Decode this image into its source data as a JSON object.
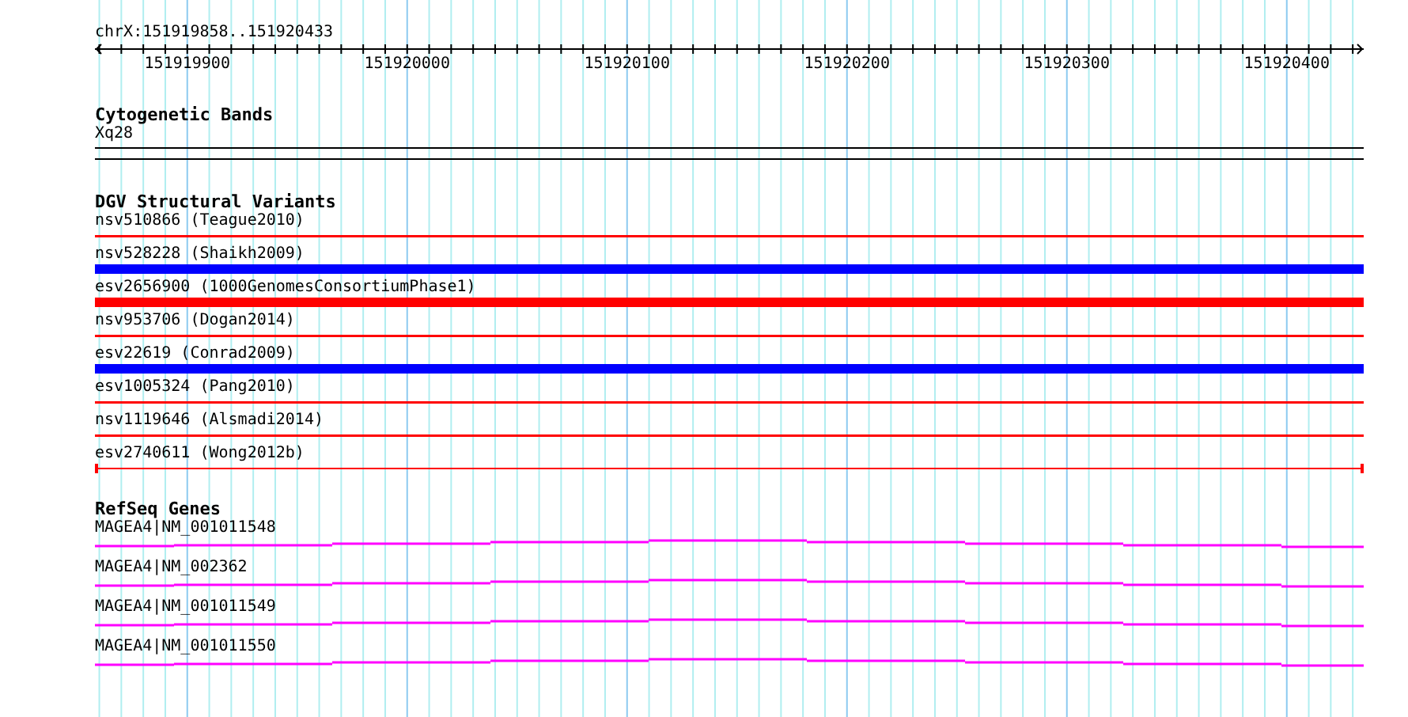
{
  "ruler": {
    "region": "chrX:151919858..151920433",
    "ticks": [
      "151919900",
      "151920000",
      "151920100",
      "151920200",
      "151920300",
      "151920400"
    ]
  },
  "tracks": [
    {
      "kind": "cytoband",
      "title": "Cytogenetic Bands",
      "features": [
        {
          "label": "Xq28"
        }
      ]
    },
    {
      "kind": "variants",
      "title": "DGV Structural Variants",
      "features": [
        {
          "label": "nsv510866 (Teague2010)",
          "kind": "thin",
          "color": "#ff0000"
        },
        {
          "label": "nsv528228 (Shaikh2009)",
          "kind": "thick",
          "color": "#0000ff"
        },
        {
          "label": "esv2656900 (1000GenomesConsortiumPhase1)",
          "kind": "thick",
          "color": "#ff0000"
        },
        {
          "label": "nsv953706 (Dogan2014)",
          "kind": "thin",
          "color": "#ff0000"
        },
        {
          "label": "esv22619 (Conrad2009)",
          "kind": "thick",
          "color": "#0000ff"
        },
        {
          "label": "esv1005324 (Pang2010)",
          "kind": "thin",
          "color": "#ff0000"
        },
        {
          "label": "nsv1119646 (Alsmadi2014)",
          "kind": "thin",
          "color": "#ff0000"
        },
        {
          "label": "esv2740611 (Wong2012b)",
          "kind": "capped",
          "color": "#ff0000"
        }
      ]
    },
    {
      "kind": "genes",
      "title": "RefSeq Genes",
      "features": [
        {
          "label": "MAGEA4|NM_001011548"
        },
        {
          "label": "MAGEA4|NM_002362"
        },
        {
          "label": "MAGEA4|NM_001011549"
        },
        {
          "label": "MAGEA4|NM_001011550"
        }
      ]
    }
  ]
}
